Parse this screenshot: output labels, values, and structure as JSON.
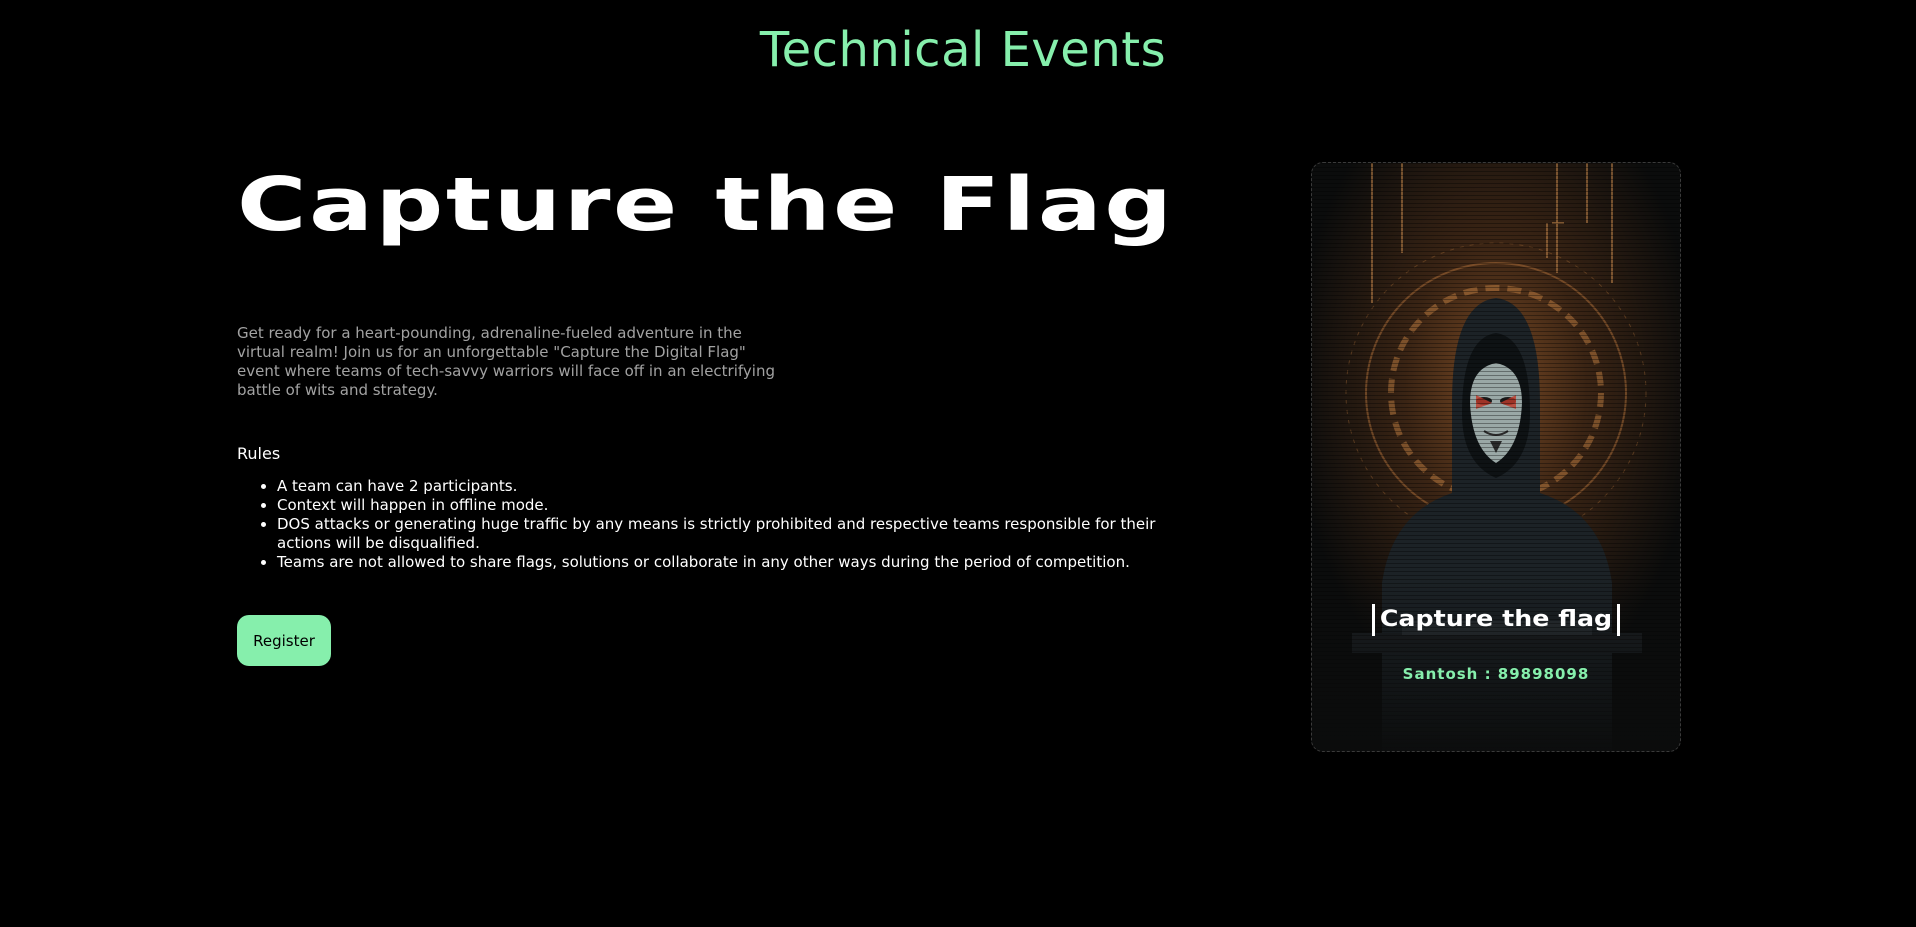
{
  "colors": {
    "accent": "#86efac",
    "background": "#000000",
    "text": "#ffffff",
    "muted": "#a2a2a2"
  },
  "header": {
    "title": "Technical Events"
  },
  "event": {
    "title": "Capture the Flag",
    "description": "Get ready for a heart-pounding, adrenaline-fueled adventure in the virtual realm! Join us for an unforgettable \"Capture the Digital Flag\" event where teams of tech-savvy warriors will face off in an electrifying battle of wits and strategy.",
    "rules_heading": "Rules",
    "rules": [
      "A team can have 2 participants.",
      "Context will happen in offline mode.",
      "DOS attacks or generating huge traffic by any means is strictly prohibited and respective teams responsible for their actions will be disqualified.",
      "Teams are not allowed to share flags, solutions or collaborate in any other ways during the period of competition."
    ],
    "register_label": "Register"
  },
  "poster": {
    "image_icon": "hooded-hacker-mask-illustration",
    "title": "Capture the flag",
    "contact": "Santosh : 89898098"
  }
}
